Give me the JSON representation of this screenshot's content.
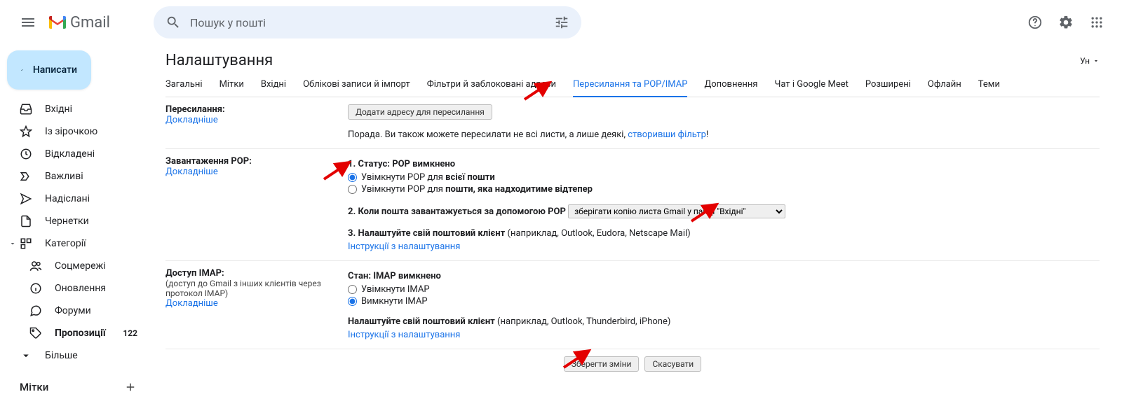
{
  "header": {
    "logo_text": "Gmail",
    "search_placeholder": "Пошук у пошті"
  },
  "compose_label": "Написати",
  "sidebar": {
    "items": [
      {
        "label": "Вхідні"
      },
      {
        "label": "Із зірочкою"
      },
      {
        "label": "Відкладені"
      },
      {
        "label": "Важливі"
      },
      {
        "label": "Надіслані"
      },
      {
        "label": "Чернетки"
      },
      {
        "label": "Категорії"
      },
      {
        "label": "Соцмережі"
      },
      {
        "label": "Оновлення"
      },
      {
        "label": "Форуми"
      },
      {
        "label": "Пропозиції",
        "badge": "122"
      },
      {
        "label": "Більше"
      }
    ],
    "labels_header": "Мітки"
  },
  "main": {
    "title": "Налаштування",
    "lang": "Ун",
    "tabs": [
      "Загальні",
      "Мітки",
      "Вхідні",
      "Облікові записи й імпорт",
      "Фільтри й заблоковані адреси",
      "Пересилання та POP/IMAP",
      "Доповнення",
      "Чат і Google Meet",
      "Розширені",
      "Офлайн",
      "Теми"
    ],
    "forwarding": {
      "title": "Пересилання:",
      "learn": "Докладніше",
      "add_btn": "Додати адресу для пересилання",
      "tip_prefix": "Порада. Ви також можете пересилати не всі листи, а лише деякі, ",
      "tip_link": "створивши фільтр",
      "tip_suffix": "!"
    },
    "pop": {
      "title": "Завантаження POP:",
      "learn": "Докладніше",
      "status_prefix": "1. Статус: ",
      "status_value": "POP вимкнено",
      "opt1_prefix": "Увімкнути POP для ",
      "opt1_bold": "всієї пошти",
      "opt2_prefix": "Увімкнути POP для ",
      "opt2_bold": "пошти, яка надходитиме відтепер",
      "step2_label": "2. Коли пошта завантажується за допомогою POP",
      "step2_select": "зберігати копію листа Gmail у папці \"Вхідні\"",
      "step3_prefix": "3. Налаштуйте свій поштовий клієнт ",
      "step3_hint": "(наприклад, Outlook, Eudora, Netscape Mail)",
      "instructions": "Інструкції з налаштування"
    },
    "imap": {
      "title": "Доступ IMAP:",
      "sub": "(доступ до Gmail з інших клієнтів через протокол IMAP)",
      "learn": "Докладніше",
      "status_prefix": "Стан: ",
      "status_value": "IMAP вимкнено",
      "opt_on": "Увімкнути IMAP",
      "opt_off": "Вимкнути IMAP",
      "cfg_prefix": "Налаштуйте свій поштовий клієнт ",
      "cfg_hint": "(наприклад, Outlook, Thunderbird, iPhone)",
      "instructions": "Інструкції з налаштування"
    },
    "save": "Зберегти зміни",
    "cancel": "Скасувати"
  }
}
